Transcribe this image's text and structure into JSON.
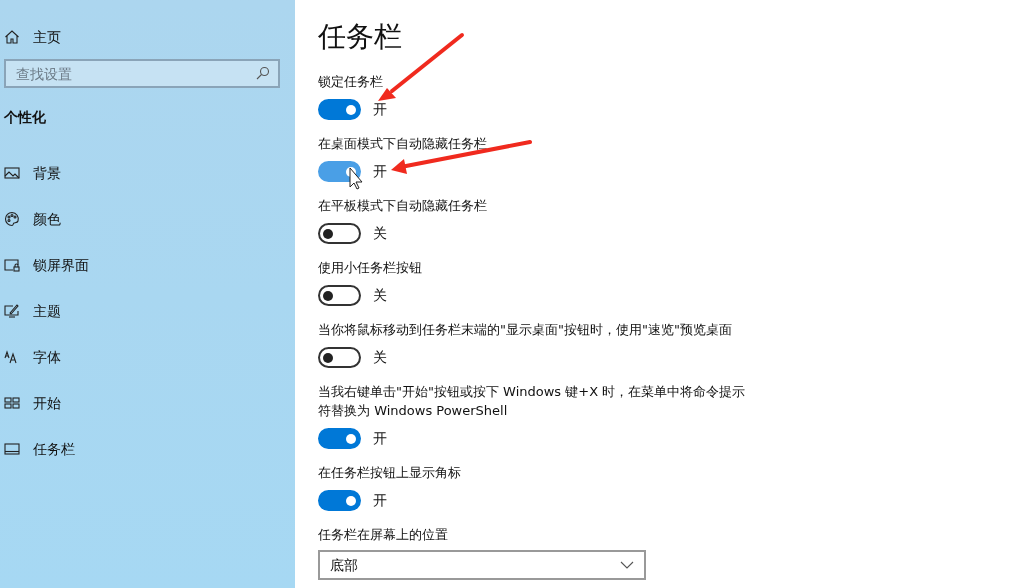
{
  "sidebar": {
    "home": "主页",
    "search": {
      "placeholder": "查找设置"
    },
    "section": "个性化",
    "items": [
      {
        "label": "背景",
        "kind": "image"
      },
      {
        "label": "颜色",
        "kind": "palette"
      },
      {
        "label": "锁屏界面",
        "kind": "lock"
      },
      {
        "label": "主题",
        "kind": "theme"
      },
      {
        "label": "字体",
        "kind": "font"
      },
      {
        "label": "开始",
        "kind": "start"
      },
      {
        "label": "任务栏",
        "kind": "taskbar"
      }
    ]
  },
  "page": {
    "title": "任务栏",
    "settings": [
      {
        "kind": "toggle",
        "label": "锁定任务栏",
        "on": true,
        "hover": false,
        "state_text": "开"
      },
      {
        "kind": "toggle",
        "label": "在桌面模式下自动隐藏任务栏",
        "on": true,
        "hover": true,
        "state_text": "开"
      },
      {
        "kind": "toggle",
        "label": "在平板模式下自动隐藏任务栏",
        "on": false,
        "hover": false,
        "state_text": "关"
      },
      {
        "kind": "toggle",
        "label": "使用小任务栏按钮",
        "on": false,
        "hover": false,
        "state_text": "关"
      },
      {
        "kind": "toggle",
        "label": "当你将鼠标移动到任务栏末端的\"显示桌面\"按钮时，使用\"速览\"预览桌面",
        "on": false,
        "hover": false,
        "state_text": "关"
      },
      {
        "kind": "toggle",
        "label": "当我右键单击\"开始\"按钮或按下 Windows 键+X 时，在菜单中将命令提示符替换为 Windows PowerShell",
        "on": true,
        "hover": false,
        "state_text": "开"
      },
      {
        "kind": "toggle",
        "label": "在任务栏按钮上显示角标",
        "on": true,
        "hover": false,
        "state_text": "开"
      },
      {
        "kind": "dropdown",
        "label": "任务栏在屏幕上的位置",
        "value": "底部"
      }
    ]
  }
}
